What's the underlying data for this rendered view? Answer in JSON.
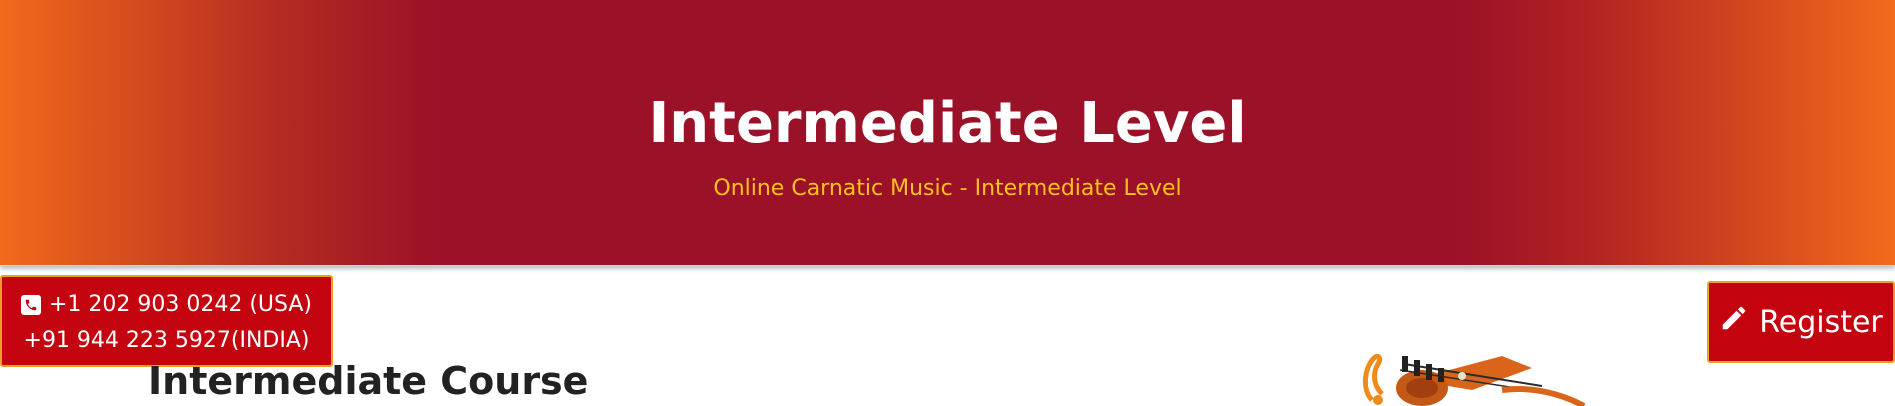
{
  "hero": {
    "title": "Intermediate Level",
    "subtitle": "Online Carnatic Music - Intermediate Level"
  },
  "contact": {
    "phone_usa": "+1 202 903 0242 (USA)",
    "phone_india": "+91 944 223 5927(INDIA)",
    "icon": "phone-square-icon"
  },
  "register": {
    "label": "Register",
    "icon": "pencil-icon"
  },
  "main": {
    "course_heading": "Intermediate Course"
  },
  "colors": {
    "hero_center": "#9b1127",
    "hero_edge": "#f26a1b",
    "subtitle": "#ffc21a",
    "button_bg": "#c4050f",
    "button_border": "#f0a020"
  }
}
